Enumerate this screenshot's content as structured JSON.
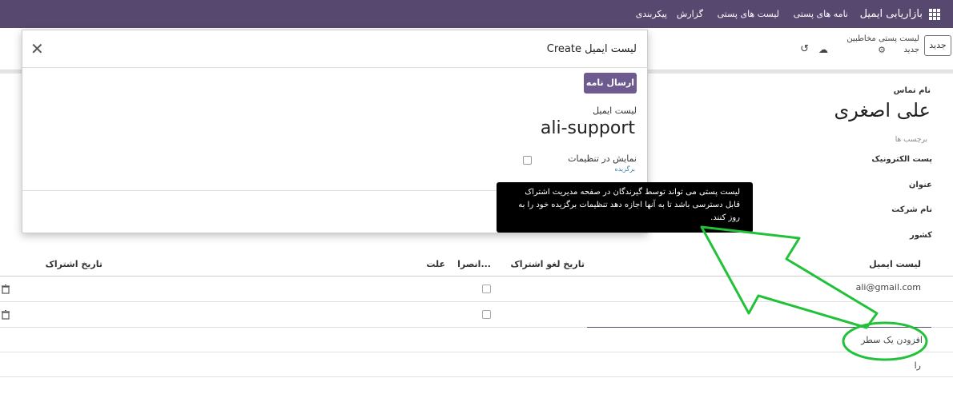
{
  "navbar": {
    "app_name": "بازاریابی ایمیل",
    "menu": [
      "نامه های پستی",
      "لیست های پستی",
      "گزارش",
      "پیکربندی"
    ]
  },
  "control": {
    "new_button": "جدید",
    "breadcrumb_title": "لیست پستی مخاطبین",
    "breadcrumb_sub": "جدید"
  },
  "sheet": {
    "contact_label": "نام تماس",
    "contact_name": "علی اصغری",
    "tags_placeholder": "برچسب ها",
    "fields": [
      "پست الکترونیک",
      "عنوان",
      "نام شرکت",
      "کشور"
    ],
    "table": {
      "headers": {
        "list": "لیست ایمیل",
        "unsub_date": "تاریخ لغو اشتراک",
        "opt_out": "انصرا...",
        "reason": "علت",
        "sub_date": "تاریخ اشتراک"
      },
      "rows": [
        {
          "email": "ali@gmail.com"
        },
        {
          "email": ""
        }
      ],
      "add_line": "افزودن یک سطر",
      "tail": "را"
    }
  },
  "modal": {
    "title": "Create لیست ایمیل",
    "send_button": "ارسال نامه",
    "list_label": "لیست ایمیل",
    "list_name": "ali-support",
    "settings_label": "نمایش در تنظیمات",
    "settings_sub": "برگزیده"
  },
  "tooltip": {
    "lines": [
      "لیست پستی می تواند توسط گیرندگان در صفحه مدیریت اشتراک",
      "قابل دسترسی باشد تا به آنها اجازه دهد تنظیمات برگزیده خود را به",
      "روز کنند."
    ]
  },
  "colors": {
    "navbar": "#57486f",
    "primary_button": "#6d5a8f",
    "annotation": "#22c13a"
  }
}
